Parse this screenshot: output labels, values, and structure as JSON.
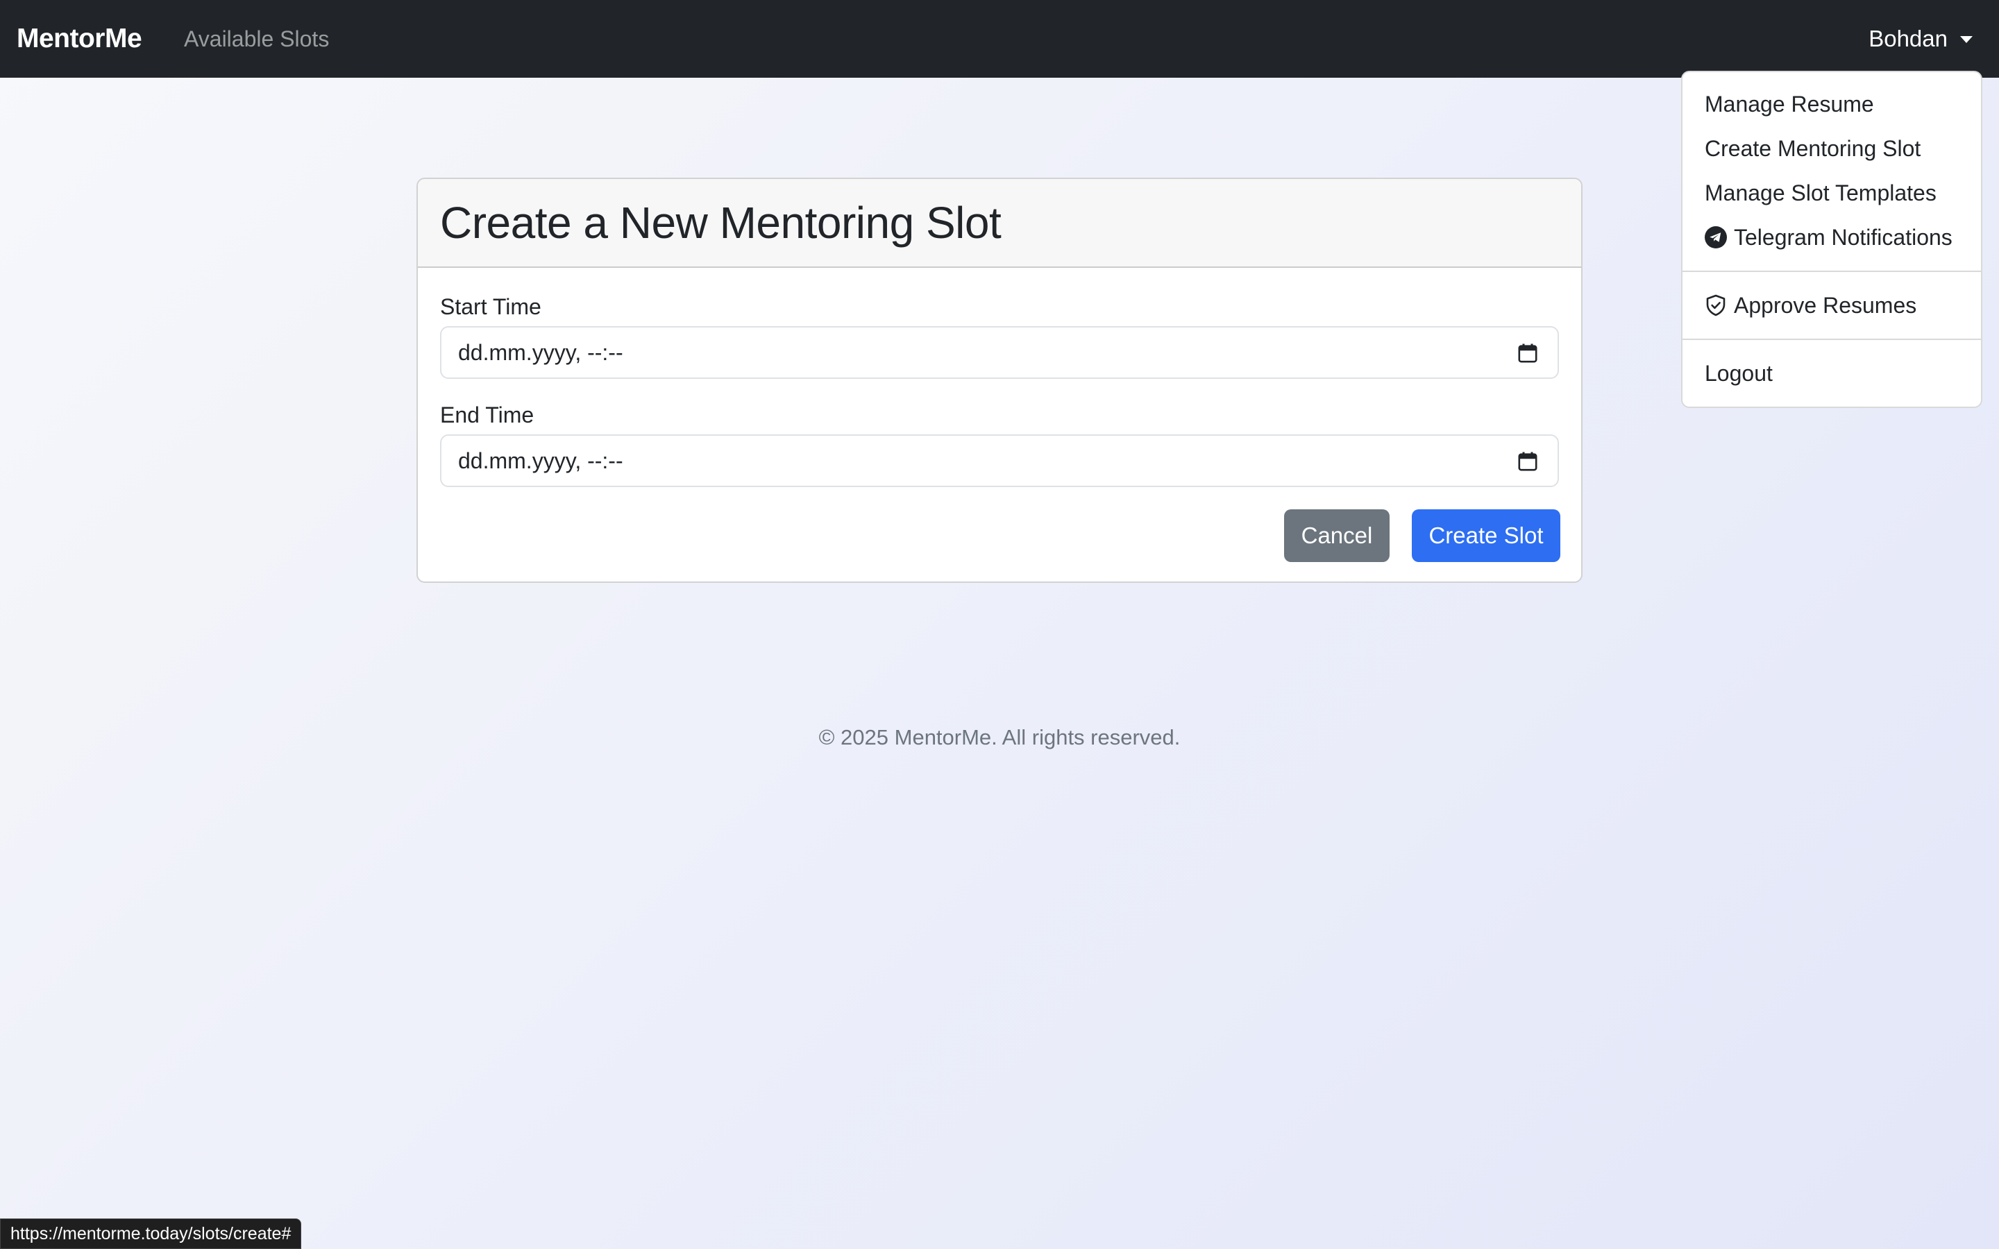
{
  "navbar": {
    "brand": "MentorMe",
    "links": [
      {
        "label": "Available Slots"
      }
    ],
    "user": {
      "name": "Bohdan"
    }
  },
  "dropdown": {
    "items": [
      {
        "label": "Manage Resume"
      },
      {
        "label": "Create Mentoring Slot"
      },
      {
        "label": "Manage Slot Templates"
      },
      {
        "label": "Telegram Notifications",
        "icon": "telegram-icon"
      },
      {
        "label": "Approve Resumes",
        "icon": "shield-check-icon"
      },
      {
        "label": "Logout"
      }
    ]
  },
  "form": {
    "title": "Create a New Mentoring Slot",
    "start": {
      "label": "Start Time",
      "value": "dd.mm.yyyy, --:--"
    },
    "end": {
      "label": "End Time",
      "value": "dd.mm.yyyy, --:--"
    },
    "cancel_label": "Cancel",
    "submit_label": "Create Slot"
  },
  "footer": {
    "text": "© 2025 MentorMe. All rights reserved."
  },
  "status_bar": {
    "url": "https://mentorme.today/slots/create#"
  },
  "colors": {
    "navbar_bg": "#212529",
    "primary": "#2d6ef2",
    "secondary": "#6c757d"
  }
}
